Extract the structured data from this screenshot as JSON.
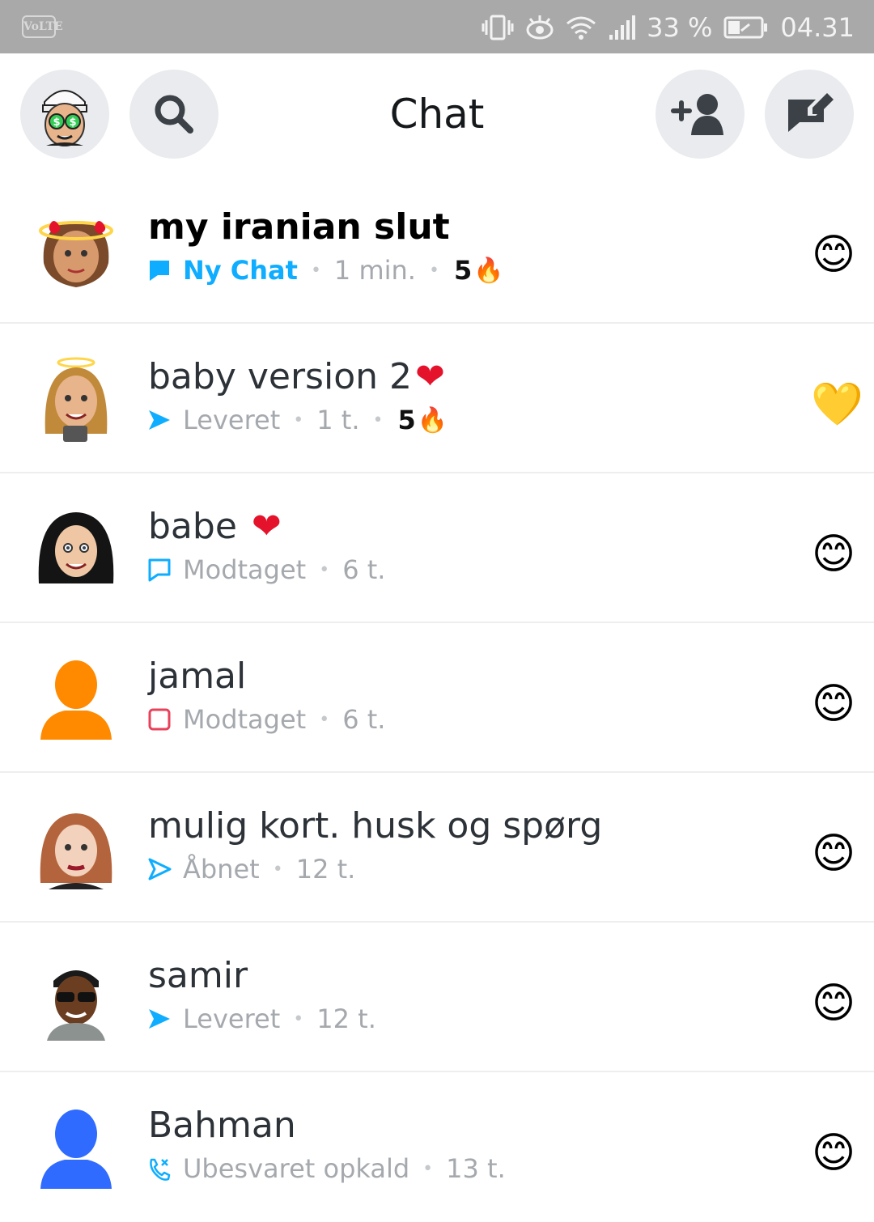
{
  "status_bar": {
    "volte": "VoLTE",
    "battery": "33 %",
    "time": "04.31"
  },
  "header": {
    "title": "Chat",
    "icons": [
      "bitmoji-avatar",
      "search-icon",
      "add-friend-icon",
      "new-chat-icon"
    ]
  },
  "chats": [
    {
      "name": "my iranian slut",
      "status": "Ny Chat",
      "time": "1 min.",
      "streak": "5",
      "streak_emoji": "🔥",
      "friend_emoji": "😊",
      "status_icon": "chat-filled-blue",
      "bold": true
    },
    {
      "name": "baby version 2",
      "name_emoji": "❤️",
      "status": "Leveret",
      "time": "1 t.",
      "streak": "5",
      "streak_emoji": "🔥",
      "friend_emoji": "💛",
      "status_icon": "arrow-filled-blue"
    },
    {
      "name": "babe ",
      "name_emoji": "❤️",
      "status": "Modtaget",
      "time": "6 t.",
      "friend_emoji": "😊",
      "status_icon": "chat-outline-blue"
    },
    {
      "name": "jamal",
      "status": "Modtaget",
      "time": "6 t.",
      "friend_emoji": "😊",
      "status_icon": "square-outline-red"
    },
    {
      "name": "mulig kort. husk og spørg",
      "status": "Åbnet",
      "time": "12 t.",
      "friend_emoji": "😊",
      "status_icon": "arrow-outline-blue"
    },
    {
      "name": "samir",
      "status": "Leveret",
      "time": "12 t.",
      "friend_emoji": "😊",
      "status_icon": "arrow-filled-blue"
    },
    {
      "name": "Bahman",
      "status": "Ubesvaret opkald",
      "time": "13 t.",
      "friend_emoji": "😊",
      "status_icon": "missed-call-blue"
    }
  ],
  "colors": {
    "status_bar": "#a9a9a9",
    "accent_blue": "#0fadff",
    "red": "#e5122b",
    "orange_avatar": "#ff8a00",
    "blue_avatar": "#2f6bff",
    "button_bg": "#e9ebee"
  }
}
